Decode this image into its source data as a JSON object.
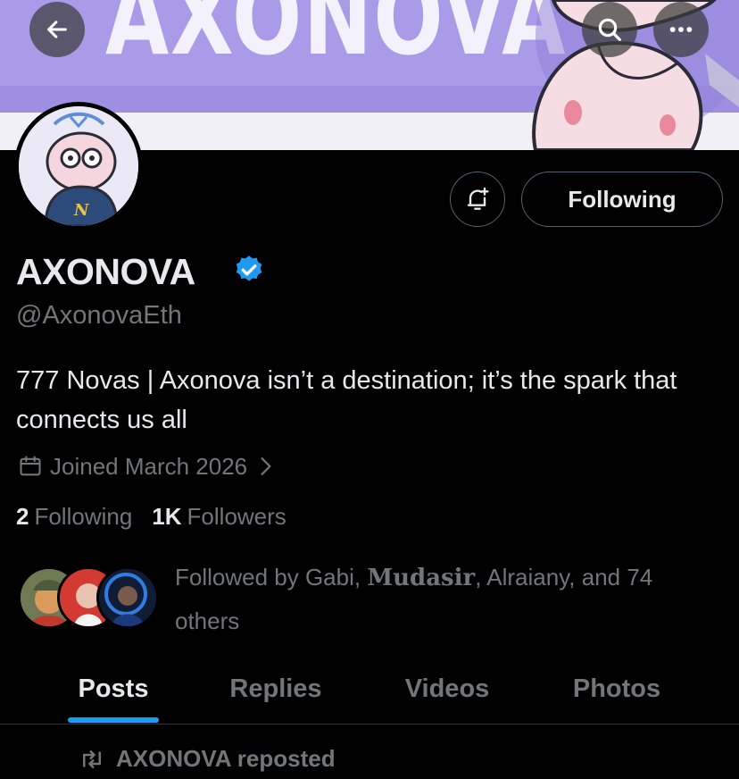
{
  "banner": {
    "title_text": "AXONOVA",
    "colors": {
      "band": "#a99be8",
      "text": "#f3f1fb"
    }
  },
  "header": {
    "back_icon": "arrow-left-icon",
    "search_icon": "search-icon",
    "more_icon": "more-horizontal-icon"
  },
  "profile": {
    "display_name": "AXONOVA",
    "verified": true,
    "verified_color": "#1d9bf0",
    "handle": "@AxonovaEth",
    "bio": "777 Novas | Axonova isn’t a destination; it’s the spark that connects us all",
    "joined": "Joined March 2026",
    "following_count": "2",
    "following_label": "Following",
    "followers_count": "1K",
    "followers_label": "Followers",
    "followed_by_prefix": "Followed by Gabi, ",
    "followed_by_name2": "Mudasir",
    "followed_by_suffix": ", Alraiany, and 74 others",
    "avatar_letter": "N"
  },
  "actions": {
    "notify_icon": "bell-plus-icon",
    "follow_label": "Following"
  },
  "tabs": [
    {
      "label": "Posts",
      "active": true
    },
    {
      "label": "Replies",
      "active": false
    },
    {
      "label": "Videos",
      "active": false
    },
    {
      "label": "Photos",
      "active": false
    }
  ],
  "feed": {
    "repost_label": "AXONOVA reposted"
  },
  "colors": {
    "background": "#000000",
    "text": "#e7e9ea",
    "muted": "#71767b",
    "accent": "#1d9bf0",
    "border": "#536471"
  }
}
